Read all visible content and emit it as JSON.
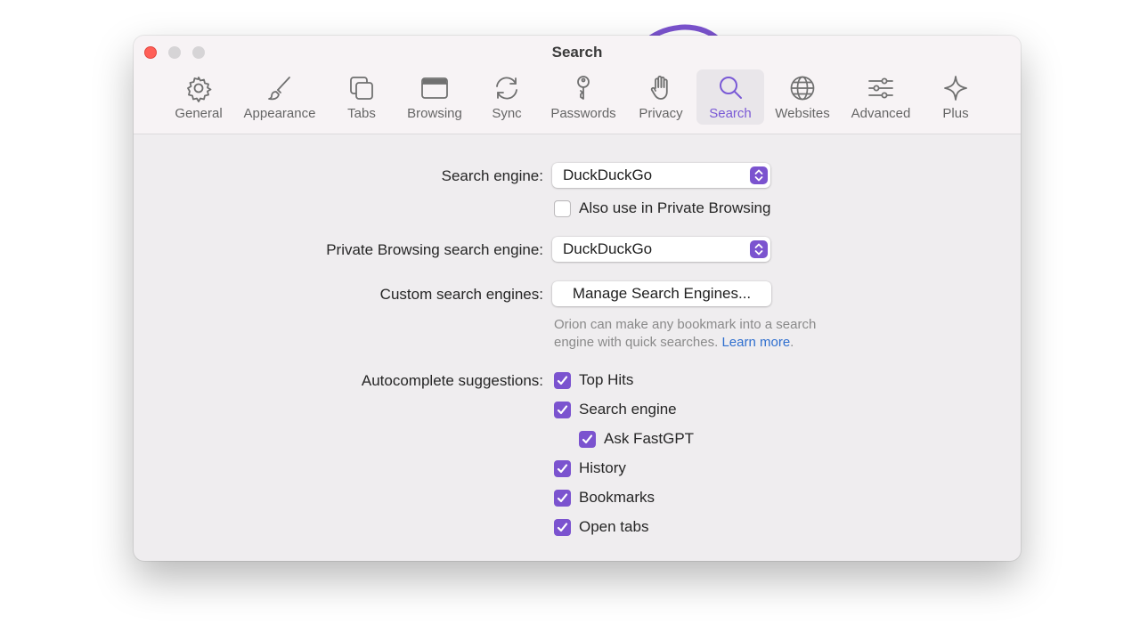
{
  "window": {
    "title": "Search"
  },
  "toolbar": {
    "items": [
      {
        "label": "General",
        "icon": "gear-icon"
      },
      {
        "label": "Appearance",
        "icon": "paintbrush-icon"
      },
      {
        "label": "Tabs",
        "icon": "tabs-icon"
      },
      {
        "label": "Browsing",
        "icon": "browser-window-icon"
      },
      {
        "label": "Sync",
        "icon": "sync-icon"
      },
      {
        "label": "Passwords",
        "icon": "key-icon"
      },
      {
        "label": "Privacy",
        "icon": "hand-icon"
      },
      {
        "label": "Search",
        "icon": "magnifier-icon"
      },
      {
        "label": "Websites",
        "icon": "globe-icon"
      },
      {
        "label": "Advanced",
        "icon": "sliders-icon"
      },
      {
        "label": "Plus",
        "icon": "sparkle-icon"
      }
    ],
    "active": "Search"
  },
  "search": {
    "engine_label": "Search engine:",
    "engine_value": "DuckDuckGo",
    "private_checkbox_label": "Also use in Private Browsing",
    "private_checkbox_checked": false,
    "private_engine_label": "Private Browsing search engine:",
    "private_engine_value": "DuckDuckGo",
    "custom_label": "Custom search engines:",
    "manage_button": "Manage Search Engines...",
    "help_line1": "Orion can make any bookmark into a search",
    "help_line2": "engine with quick searches.",
    "help_link": "Learn more",
    "help_end": ".",
    "autocomplete_label": "Autocomplete suggestions:",
    "autocomplete": [
      {
        "label": "Top Hits",
        "checked": true
      },
      {
        "label": "Search engine",
        "checked": true
      },
      {
        "label": "Ask FastGPT",
        "checked": true
      },
      {
        "label": "History",
        "checked": true
      },
      {
        "label": "Bookmarks",
        "checked": true
      },
      {
        "label": "Open tabs",
        "checked": true
      }
    ]
  },
  "colors": {
    "accent": "#7b53cf",
    "link": "#2f6fcf",
    "close": "#ff5f57",
    "annotation_arrow": "#7b53cf"
  }
}
